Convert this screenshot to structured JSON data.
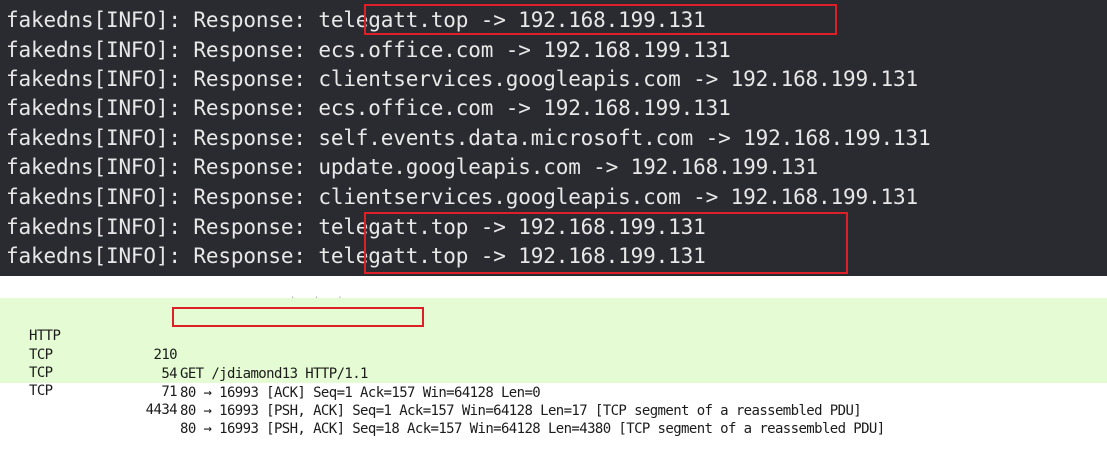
{
  "terminal": {
    "background": "#2a2b31",
    "text_color": "#e8e8e8",
    "highlight_color": "#dd1f28",
    "lines": [
      {
        "prefix": "fakedns[INFO]: Response: ",
        "entry": "telegatt.top -> 192.168.199.131",
        "highlighted": true
      },
      {
        "prefix": "fakedns[INFO]: Response: ",
        "entry": "ecs.office.com -> 192.168.199.131",
        "highlighted": false
      },
      {
        "prefix": "fakedns[INFO]: Response: ",
        "entry": "clientservices.googleapis.com -> 192.168.199.131",
        "highlighted": false
      },
      {
        "prefix": "fakedns[INFO]: Response: ",
        "entry": "ecs.office.com -> 192.168.199.131",
        "highlighted": false
      },
      {
        "prefix": "fakedns[INFO]: Response: ",
        "entry": "self.events.data.microsoft.com -> 192.168.199.131",
        "highlighted": false
      },
      {
        "prefix": "fakedns[INFO]: Response: ",
        "entry": "update.googleapis.com -> 192.168.199.131",
        "highlighted": false
      },
      {
        "prefix": "fakedns[INFO]: Response: ",
        "entry": "clientservices.googleapis.com -> 192.168.199.131",
        "highlighted": false
      },
      {
        "prefix": "fakedns[INFO]: Response: ",
        "entry": "telegatt.top -> 192.168.199.131",
        "highlighted": true
      },
      {
        "prefix": "fakedns[INFO]: Response: ",
        "entry": "telegatt.top -> 192.168.199.131",
        "highlighted": true
      }
    ]
  },
  "packet_list": {
    "row_background": "#e5fbd3",
    "rows": [
      {
        "protocol": "HTTP",
        "length": "210",
        "info": "GET /jdiamond13 HTTP/1.1",
        "info_highlighted": true
      },
      {
        "protocol": "TCP",
        "length": "54",
        "info": "80 → 16993 [ACK] Seq=1 Ack=157 Win=64128 Len=0",
        "info_highlighted": false
      },
      {
        "protocol": "TCP",
        "length": "71",
        "info": "80 → 16993 [PSH, ACK] Seq=1 Ack=157 Win=64128 Len=17 [TCP segment of a reassembled PDU]",
        "info_highlighted": false
      },
      {
        "protocol": "TCP",
        "length": "4434",
        "info": "80 → 16993 [PSH, ACK] Seq=18 Ack=157 Win=64128 Len=4380 [TCP segment of a reassembled PDU]",
        "info_highlighted": false
      }
    ]
  }
}
